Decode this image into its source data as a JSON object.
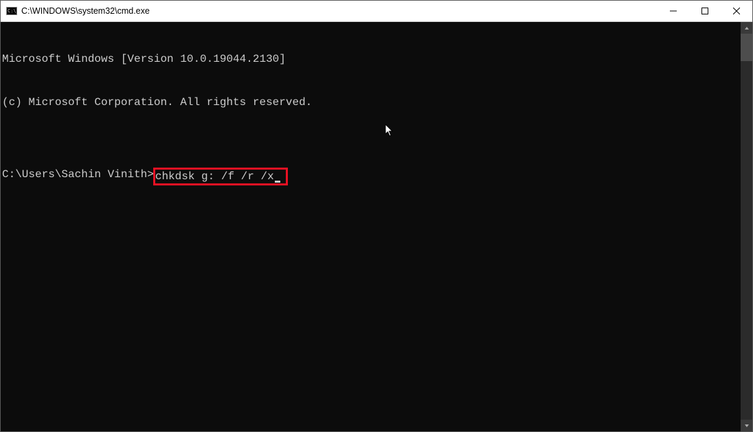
{
  "titlebar": {
    "title": "C:\\WINDOWS\\system32\\cmd.exe"
  },
  "console": {
    "line1": "Microsoft Windows [Version 10.0.19044.2130]",
    "line2": "(c) Microsoft Corporation. All rights reserved.",
    "blank": "",
    "prompt_path": "C:\\Users\\Sachin Vinith>",
    "command": "chkdsk g: /f /r /x"
  }
}
